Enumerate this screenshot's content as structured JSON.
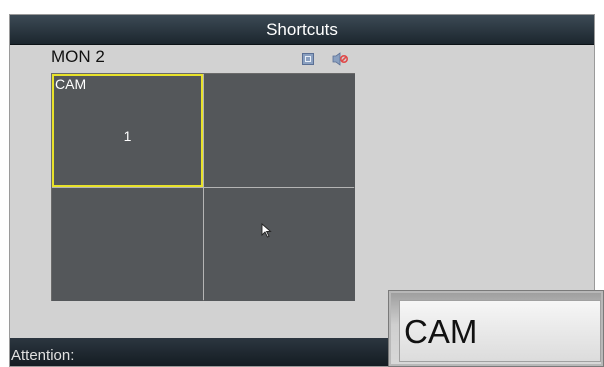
{
  "window": {
    "title": "Shortcuts"
  },
  "monitor": {
    "label": "MON 2"
  },
  "icons": {
    "fullscreen": "fullscreen-icon",
    "mute": "mute-icon",
    "cursor": "mouse-pointer-icon"
  },
  "grid": {
    "cells": [
      {
        "label": "CAM",
        "number": "1",
        "selected": true
      },
      {
        "label": "",
        "number": ""
      },
      {
        "label": "",
        "number": ""
      },
      {
        "label": "",
        "number": ""
      }
    ]
  },
  "status": {
    "text": "Attention:"
  },
  "popup_button": {
    "label": "CAM"
  },
  "colors": {
    "selection": "#e8e22a",
    "cell": "#54575a",
    "titlebar": "#1c262e"
  }
}
